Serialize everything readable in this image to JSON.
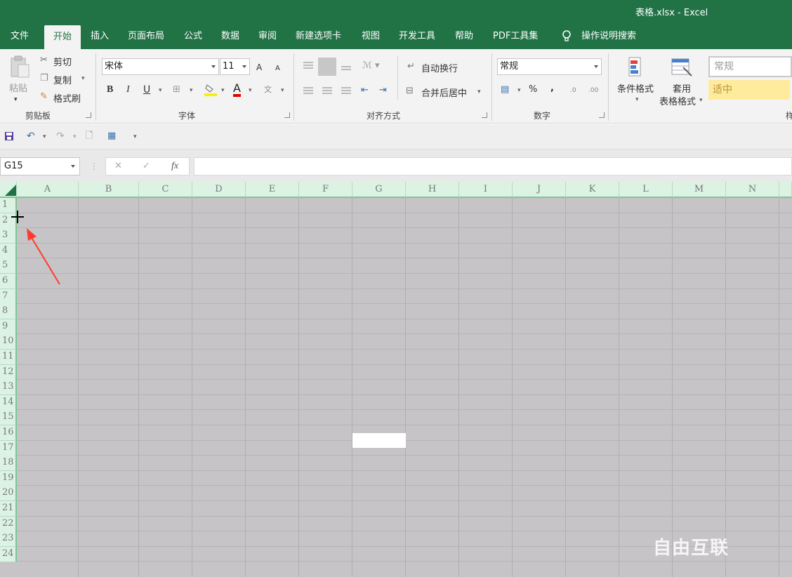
{
  "window": {
    "title": "表格.xlsx  -  Excel"
  },
  "tabs": [
    "文件",
    "开始",
    "插入",
    "页面布局",
    "公式",
    "数据",
    "审阅",
    "新建选项卡",
    "视图",
    "开发工具",
    "帮助",
    "PDF工具集",
    "操作说明搜索"
  ],
  "active_tab": "开始",
  "ribbon": {
    "clipboard": {
      "paste": "粘贴",
      "cut": "剪切",
      "copy": "复制",
      "format_painter": "格式刷",
      "label": "剪贴板"
    },
    "font": {
      "name": "宋体",
      "size": "11",
      "bold": "B",
      "italic": "I",
      "underline": "U",
      "grow": "A",
      "shrink": "A",
      "font_color": "A",
      "phonetic": "文",
      "label": "字体"
    },
    "alignment": {
      "wrap": "自动换行",
      "merge": "合并后居中",
      "label": "对齐方式"
    },
    "number": {
      "format": "常规",
      "percent": "%",
      "comma": ",",
      "label": "数字"
    },
    "styles": {
      "conditional": "条件格式",
      "table_format_1": "套用",
      "table_format_2": "表格格式",
      "style_normal": "常规",
      "style_neutral": "适中",
      "label_partial": "样"
    }
  },
  "formula_bar": {
    "name_box": "G15",
    "cancel": "✕",
    "enter": "✓",
    "fx": "fx",
    "value": ""
  },
  "sheet": {
    "columns": [
      "A",
      "B",
      "C",
      "D",
      "E",
      "F",
      "G",
      "H",
      "I",
      "J",
      "K",
      "L",
      "M",
      "N"
    ],
    "rows": [
      "1",
      "2",
      "3",
      "4",
      "5",
      "6",
      "7",
      "8",
      "9",
      "10",
      "11",
      "12",
      "13",
      "14",
      "15",
      "16",
      "17",
      "18",
      "19",
      "20",
      "21",
      "22",
      "23",
      "24"
    ],
    "active_cell": "G15"
  },
  "watermark": "自由互联",
  "colors": {
    "accent": "#217346",
    "sheet_dimmed": "#c6c4c6",
    "header_bg": "#dcf3e4",
    "neutral_style": "#ffeb9c",
    "annotation_arrow": "#ff3b30"
  }
}
